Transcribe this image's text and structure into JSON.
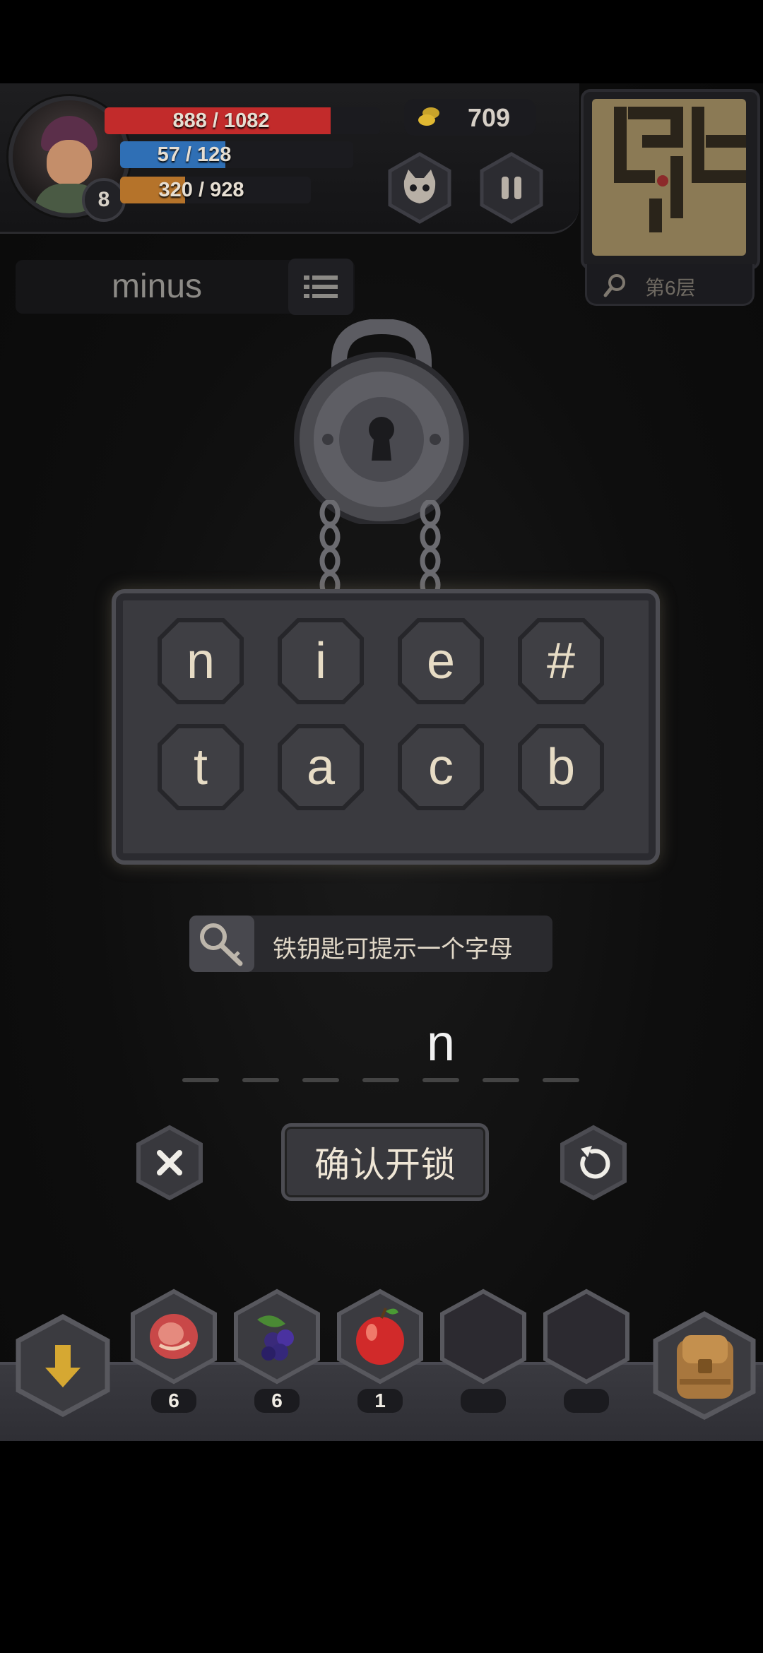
{
  "hud": {
    "level": "8",
    "hp": {
      "text": "888 / 1082",
      "fraction": 0.82,
      "color": "#c22b2b"
    },
    "mp": {
      "text": "57 / 128",
      "fraction": 0.45,
      "color": "#2f6fb5"
    },
    "xp": {
      "text": "320 / 928",
      "fraction": 0.34,
      "color": "#b5732a"
    },
    "coins": "709",
    "coin_icon": "coin-icon",
    "pet_icon": "monster-face-icon",
    "pause_icon": "pause-icon",
    "floor_label": "第6层",
    "search_icon": "search-icon"
  },
  "header": {
    "title": "minus",
    "menu_icon": "list-icon"
  },
  "lock": {
    "icon": "padlock-icon",
    "keys_row1": [
      "n",
      "i",
      "e",
      "#"
    ],
    "keys_row2": [
      "t",
      "a",
      "c",
      "b"
    ]
  },
  "hint": {
    "icon": "key-icon",
    "text": "铁钥匙可提示一个字母"
  },
  "answer": {
    "revealed_letter": "n",
    "revealed_index": 4,
    "slots": 7
  },
  "actions": {
    "cancel_icon": "close-icon",
    "confirm_label": "确认开锁",
    "reset_icon": "refresh-icon"
  },
  "inventory": {
    "descend_icon": "arrow-down-icon",
    "slots": [
      {
        "icon": "meat-icon",
        "count": "6"
      },
      {
        "icon": "berries-icon",
        "count": "6"
      },
      {
        "icon": "apple-icon",
        "count": "1"
      },
      {
        "icon": "",
        "count": ""
      },
      {
        "icon": "",
        "count": ""
      }
    ],
    "bag_icon": "backpack-icon"
  }
}
